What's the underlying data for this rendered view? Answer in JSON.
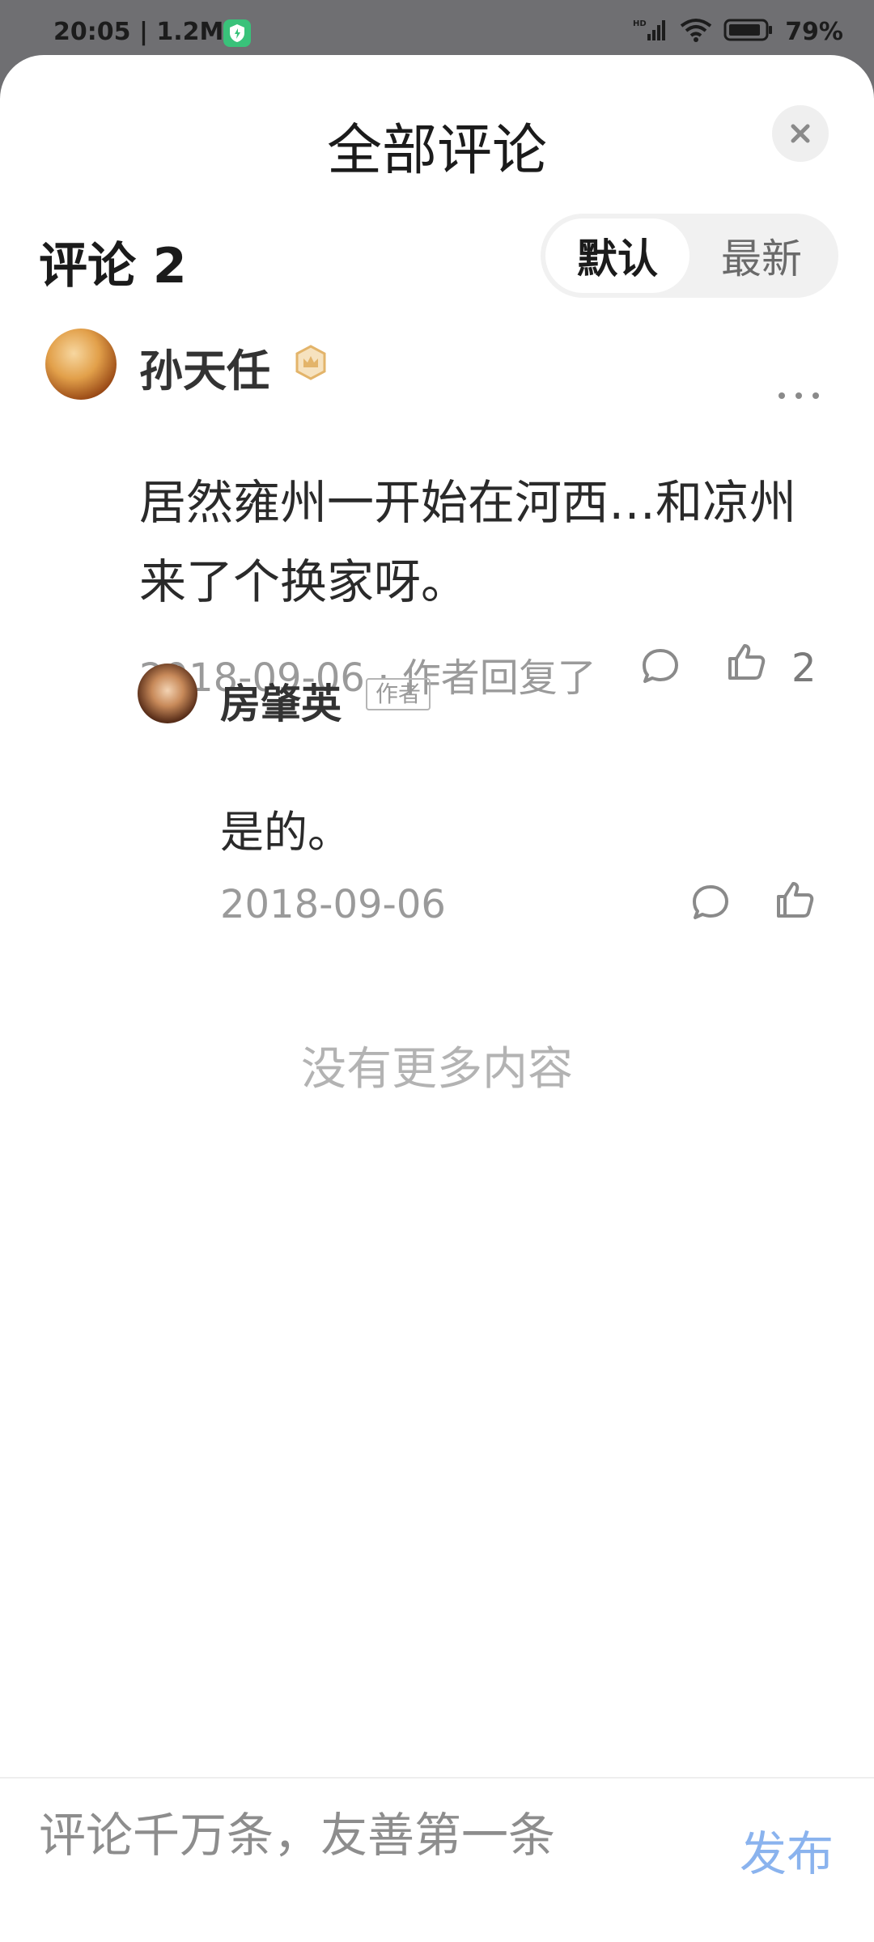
{
  "status_bar": {
    "time_speed": "20:05 | 1.2M/s",
    "battery_pct": "79%",
    "icons": [
      "shield-icon",
      "hd-signal-icon",
      "wifi-icon",
      "battery-icon"
    ]
  },
  "header": {
    "title": "全部评论",
    "close_icon": "close-icon"
  },
  "toolbar": {
    "count_label": "评论 2",
    "sort_options": [
      "默认",
      "最新"
    ],
    "active_sort": "默认"
  },
  "comments": [
    {
      "username": "孙天任",
      "badge_icon": "level-badge-icon",
      "text": "居然雍州一开始在河西…和凉州来了个换家呀。",
      "meta": "2018-09-06 · 作者回复了",
      "like_count": "2",
      "replies": [
        {
          "username": "房肇英",
          "tag": "作者",
          "text": "是的。",
          "meta": "2018-09-06"
        }
      ]
    }
  ],
  "footer": {
    "no_more_text": "没有更多内容",
    "input_placeholder": "评论千万条，友善第一条",
    "publish_label": "发布"
  },
  "colors": {
    "accent_publish": "#8ab3ee",
    "badge_gold": "#e3b46a",
    "secondary_text": "#9a9a9a"
  }
}
